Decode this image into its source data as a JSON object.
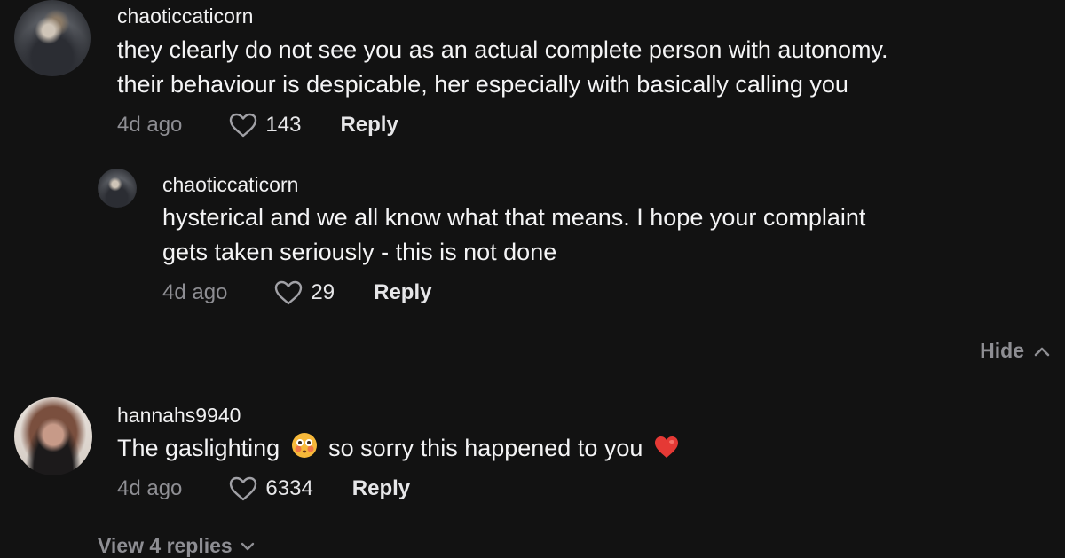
{
  "colors": {
    "background": "#121212",
    "primary_text": "#f1f1f2",
    "secondary_text": "#8e8e93",
    "heart_emoji": "#e53935"
  },
  "comments": [
    {
      "username": "chaoticcaticorn",
      "avatar": "cat-photo-avatar",
      "lines": [
        "they clearly do not see you as an actual complete person with autonomy.",
        "their behaviour is despicable, her especially with basically calling you"
      ],
      "time": "4d ago",
      "likes": "143",
      "reply_label": "Reply",
      "replies": [
        {
          "username": "chaoticcaticorn",
          "avatar": "cat-photo-avatar",
          "lines": [
            "hysterical and we all know what that means. I hope your complaint",
            "gets taken seriously - this is not done"
          ],
          "time": "4d ago",
          "likes": "29",
          "reply_label": "Reply"
        }
      ],
      "hide_label": "Hide"
    },
    {
      "username": "hannahs9940",
      "avatar": "woman-photo-avatar",
      "text_before_emoji": "The gaslighting",
      "emoji_1": "flushed-face-emoji",
      "text_after_emoji": "so sorry this happened to you",
      "emoji_2": "red-heart-emoji",
      "time": "4d ago",
      "likes": "6334",
      "reply_label": "Reply",
      "view_replies_label": "View 4 replies"
    }
  ]
}
